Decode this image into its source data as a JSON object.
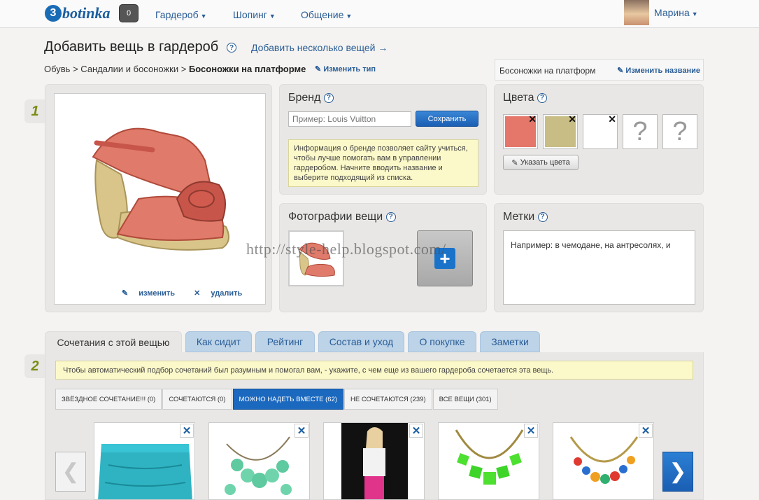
{
  "topbar": {
    "logo_glyph": "3",
    "logo_text": "botinka",
    "badge": "0",
    "nav": [
      {
        "label": "Гардероб"
      },
      {
        "label": "Шопинг"
      },
      {
        "label": "Общение"
      }
    ],
    "user": "Марина"
  },
  "header": {
    "title": "Добавить вещь в гардероб",
    "add_several": "Добавить несколько вещей →",
    "breadcrumb": [
      "Обувь",
      "Сандалии и босоножки",
      "Босоножки на платформе"
    ],
    "edit_type": "Изменить тип",
    "item_name": "Босоножки на платформ",
    "edit_name": "Изменить название"
  },
  "steps": [
    "1",
    "2"
  ],
  "photo": {
    "edit": "изменить",
    "delete": "удалить"
  },
  "brand": {
    "title": "Бренд",
    "placeholder": "Пример: Louis Vuitton",
    "save": "Сохранить",
    "info": "Информация о бренде позволяет сайту учиться, чтобы лучше помогать вам в управлении гардеробом. Начните вводить название и выберите подходящий из списка."
  },
  "colors": {
    "title": "Цвета",
    "swatches": [
      "#e4766a",
      "#c8bd84",
      "#ffffff"
    ],
    "empty": "?",
    "button": "Указать цвета"
  },
  "photos": {
    "title": "Фотографии вещи"
  },
  "tags": {
    "title": "Метки",
    "placeholder": "Например: в чемодане, на антресолях, и"
  },
  "watermark": "http://style-help.blogspot.com/",
  "tabs": [
    "Сочетания с этой вещью",
    "Как сидит",
    "Рейтинг",
    "Состав и уход",
    "О покупке",
    "Заметки"
  ],
  "combos": {
    "tip": "Чтобы автоматический подбор сочетаний был разумным и помогал вам, - укажите, с чем еще из вашего гардероба сочетается эта вещь.",
    "filters": [
      "ЗВЁЗДНОЕ СОЧЕТАНИЕ!!! (0)",
      "СОЧЕТАЮТСЯ (0)",
      "МОЖНО НАДЕТЬ ВМЕСТЕ (62)",
      "НЕ СОЧЕТАЮТСЯ (239)",
      "ВСЕ ВЕЩИ (301)"
    ],
    "remove": "✕"
  },
  "accent": "#1b68bf"
}
